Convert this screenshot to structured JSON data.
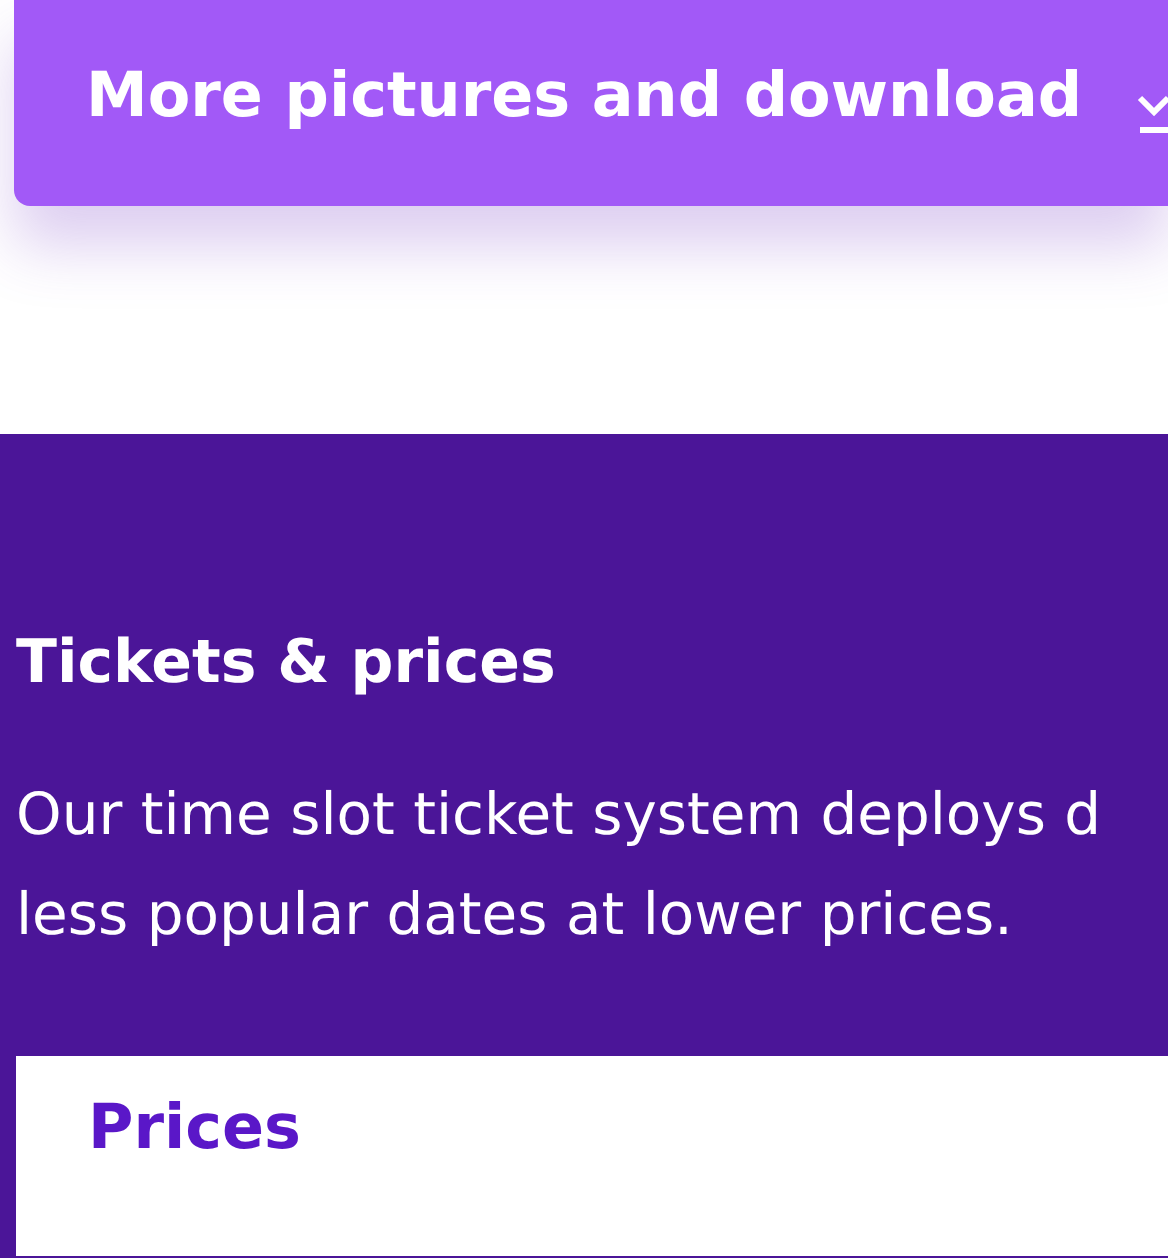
{
  "download_button": {
    "label": "More pictures and download"
  },
  "tickets_section": {
    "heading": "Tickets & prices",
    "paragraph_lines": [
      "Our time slot ticket system deploys d",
      "less popular dates at lower prices."
    ]
  },
  "prices_card": {
    "heading": "Prices"
  }
}
